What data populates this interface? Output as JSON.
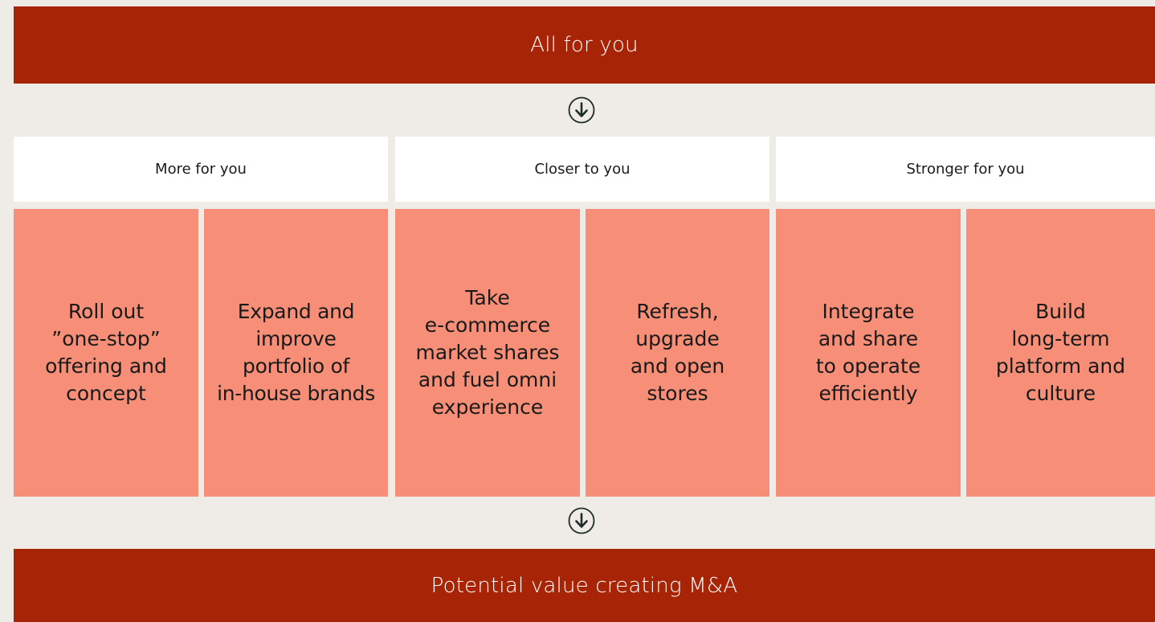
{
  "top_banner": {
    "text": "All for you"
  },
  "bottom_banner": {
    "text": "Potential value creating M&A"
  },
  "arrows": [
    {
      "icon": "arrow-down-circle-icon"
    },
    {
      "icon": "arrow-down-circle-icon"
    }
  ],
  "pillars": [
    {
      "title": "More for you"
    },
    {
      "title": "Closer to you"
    },
    {
      "title": "Stronger for you"
    }
  ],
  "initiatives": [
    {
      "text": "Roll out\n”one-stop”\noffering and\nconcept"
    },
    {
      "text": "Expand and\nimprove\nportfolio of\nin-house brands"
    },
    {
      "text": "Take\ne-commerce\nmarket shares\nand fuel omni\nexperience"
    },
    {
      "text": "Refresh,\nupgrade\nand open\nstores"
    },
    {
      "text": "Integrate\nand share\nto operate\nefficiently"
    },
    {
      "text": "Build\nlong-term\nplatform and\nculture"
    }
  ],
  "colors": {
    "background": "#efebe7",
    "banner": "#a82407",
    "header": "#ffffff",
    "box": "#f78f78",
    "icon": "#1e2a26"
  }
}
